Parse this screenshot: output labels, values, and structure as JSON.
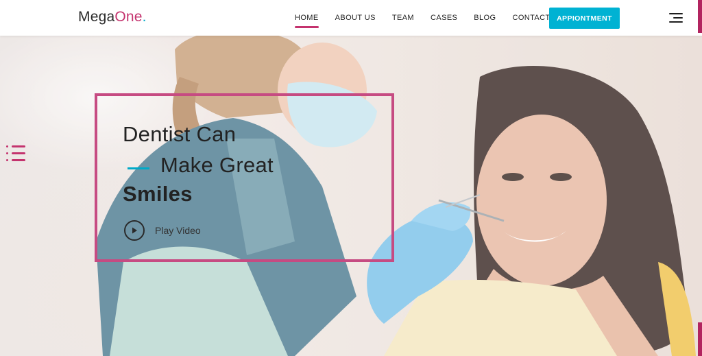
{
  "brand": {
    "name_part1": "Mega",
    "name_part2": "One",
    "name_dot": ".",
    "colors": {
      "primary": "#c4336e",
      "secondary": "#00b2d3",
      "text": "#222222"
    }
  },
  "nav": {
    "items": [
      {
        "label": "HOME",
        "active": true
      },
      {
        "label": "ABOUT US",
        "active": false
      },
      {
        "label": "TEAM",
        "active": false
      },
      {
        "label": "CASES",
        "active": false
      },
      {
        "label": "BLOG",
        "active": false
      },
      {
        "label": "CONTACT",
        "active": false
      }
    ],
    "cta_label": "APPIONTMENT",
    "menu_icon": "hamburger-menu-icon"
  },
  "side_menu": {
    "icon": "list-menu-icon"
  },
  "hero": {
    "line1": "Dentist Can",
    "line2": "Make Great",
    "line3": "Smiles",
    "play_label": "Play Video",
    "play_icon": "play-icon"
  }
}
